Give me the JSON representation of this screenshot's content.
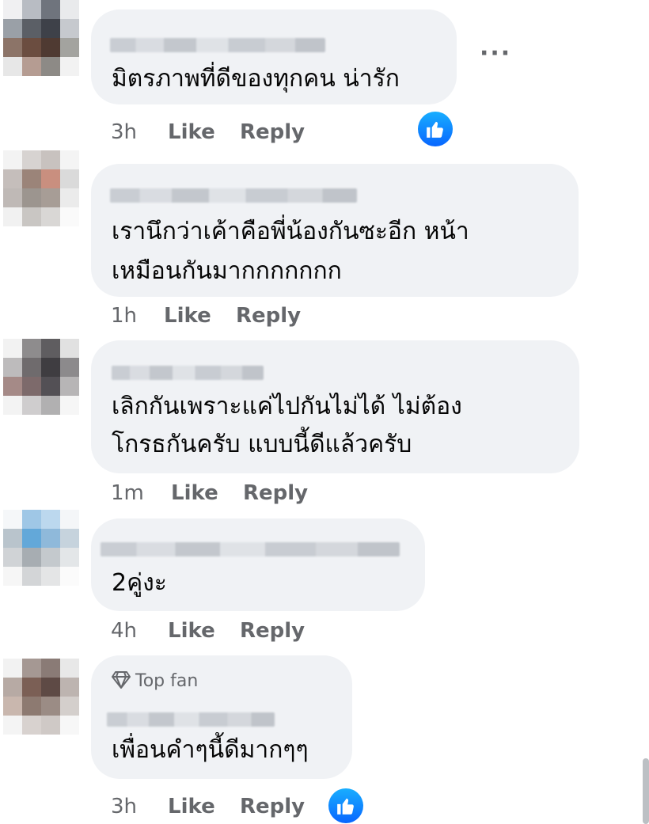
{
  "comments": [
    {
      "text_lines": [
        "มิตรภาพที่ดีของทุกคน น่ารัก"
      ],
      "time": "3h",
      "like_label": "Like",
      "reply_label": "Reply",
      "has_reaction": true,
      "more_label": "···",
      "avatar_colors": [
        "#f0f0f2",
        "#b8bcc3",
        "#6f747d",
        "#e9eaec",
        "#9aa0a7",
        "#5b5f66",
        "#3e4149",
        "#c6c9ce",
        "#8c7468",
        "#6b4d40",
        "#4f3a32",
        "#a3a39f",
        "#e7e7e7",
        "#b59c92",
        "#8d8a86",
        "#f2f2f2"
      ]
    },
    {
      "text_lines": [
        "เรานึกว่าเค้าคือพี่น้องกันซะอีก หน้า",
        "เหมือนกันมากกกกกกก"
      ],
      "time": "1h",
      "like_label": "Like",
      "reply_label": "Reply",
      "has_reaction": false,
      "avatar_colors": [
        "#f3f3f3",
        "#d7d3d1",
        "#c8c2bf",
        "#f4f4f4",
        "#c5bebb",
        "#9b8479",
        "#c98f7f",
        "#dadada",
        "#bfb9b6",
        "#9c958f",
        "#a79d96",
        "#ebebeb",
        "#f1f1f1",
        "#c9c6c3",
        "#d9d7d5",
        "#fafafa"
      ]
    },
    {
      "text_lines": [
        "เลิกกันเพราะแค่ไปกันไม่ได้ ไม่ต้อง",
        "โกรธกันครับ แบบนี้ดีแล้วครับ"
      ],
      "time": "1m",
      "like_label": "Like",
      "reply_label": "Reply",
      "has_reaction": false,
      "avatar_colors": [
        "#f2f2f2",
        "#8e8c8d",
        "#5f5d60",
        "#e1e1e1",
        "#bdbbbc",
        "#6f6b6d",
        "#3f3d41",
        "#8c8a8c",
        "#a58a87",
        "#7d6a6b",
        "#535055",
        "#b7b5b6",
        "#f3f3f3",
        "#cfcdce",
        "#b1b0b1",
        "#f6f6f6"
      ]
    },
    {
      "text_lines": [
        "2คู่งะ"
      ],
      "time": "4h",
      "like_label": "Like",
      "reply_label": "Reply",
      "has_reaction": false,
      "avatar_colors": [
        "#f5f7f9",
        "#9fc7e6",
        "#bcd8ee",
        "#f4f6f8",
        "#b9c4cc",
        "#63a8d9",
        "#8fb9da",
        "#c6d3dd",
        "#d0d3d6",
        "#a7adb2",
        "#c4c9cd",
        "#e3e6e8",
        "#f6f6f6",
        "#d3d5d7",
        "#e4e5e6",
        "#fbfbfb"
      ]
    },
    {
      "badge": "Top fan",
      "text_lines": [
        "เพื่อนคำๆนี้ดีมากๆๆ"
      ],
      "time": "3h",
      "like_label": "Like",
      "reply_label": "Reply",
      "has_reaction": true,
      "avatar_colors": [
        "#f2f2f2",
        "#a59893",
        "#8a7b76",
        "#e8e8e8",
        "#b7aaa4",
        "#7b5f55",
        "#5e4a45",
        "#bdb4b0",
        "#c9b7ae",
        "#8d7a71",
        "#9b8c85",
        "#d4cfcc",
        "#f4f4f4",
        "#d8d2cf",
        "#cfc9c6",
        "#f7f7f7"
      ]
    }
  ]
}
